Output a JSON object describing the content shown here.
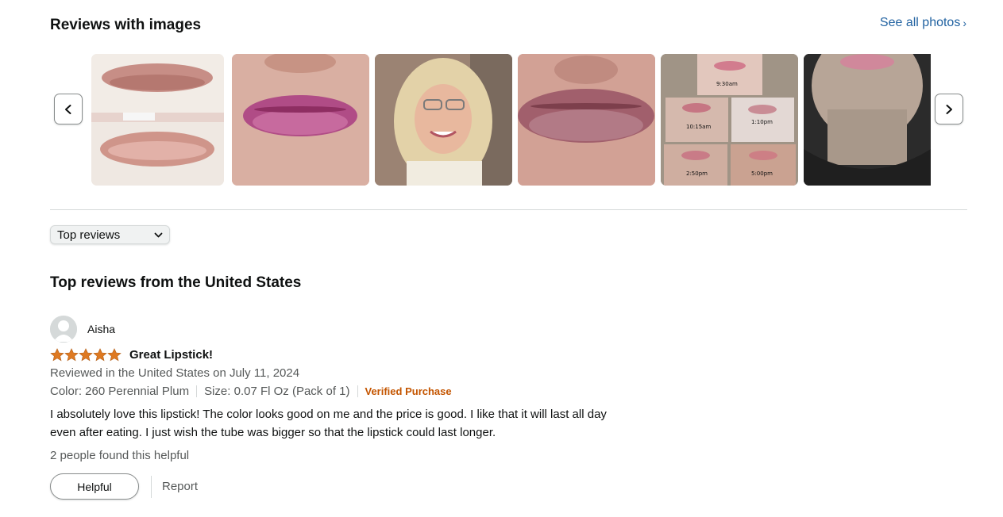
{
  "gallery": {
    "title": "Reviews with images",
    "see_all_label": "See all photos",
    "prev_icon": "chevron-left-icon",
    "next_icon": "chevron-right-icon",
    "thumbnails": [
      {
        "caption": "",
        "labels": []
      },
      {
        "caption": "",
        "labels": []
      },
      {
        "caption": "",
        "labels": []
      },
      {
        "caption": "",
        "labels": []
      },
      {
        "caption": "",
        "labels": [
          "9:30am",
          "10:15am",
          "1:10pm",
          "2:50pm",
          "5:00pm"
        ]
      },
      {
        "caption": "",
        "labels": []
      }
    ]
  },
  "sort": {
    "selected": "Top reviews"
  },
  "reviews_section": {
    "title": "Top reviews from the United States"
  },
  "review": {
    "author": "Aisha",
    "rating": 5,
    "rating_max": 5,
    "title": "Great Lipstick!",
    "date_line": "Reviewed in the United States on July 11, 2024",
    "color": "Color: 260 Perennial Plum",
    "size": "Size: 0.07 Fl Oz (Pack of 1)",
    "verified": "Verified Purchase",
    "body_line1": "I absolutely love this lipstick! The color looks good on me and the price is good. I like that it will last all day",
    "body_line2": "even after eating. I just wish the tube was bigger so that the lipstick could last longer.",
    "helpful_count": "2 people found this helpful",
    "helpful_button": "Helpful",
    "report_label": "Report"
  },
  "colors": {
    "link": "#2162a1",
    "star": "#de7921",
    "verified": "#c45500",
    "muted_text": "#565959"
  }
}
